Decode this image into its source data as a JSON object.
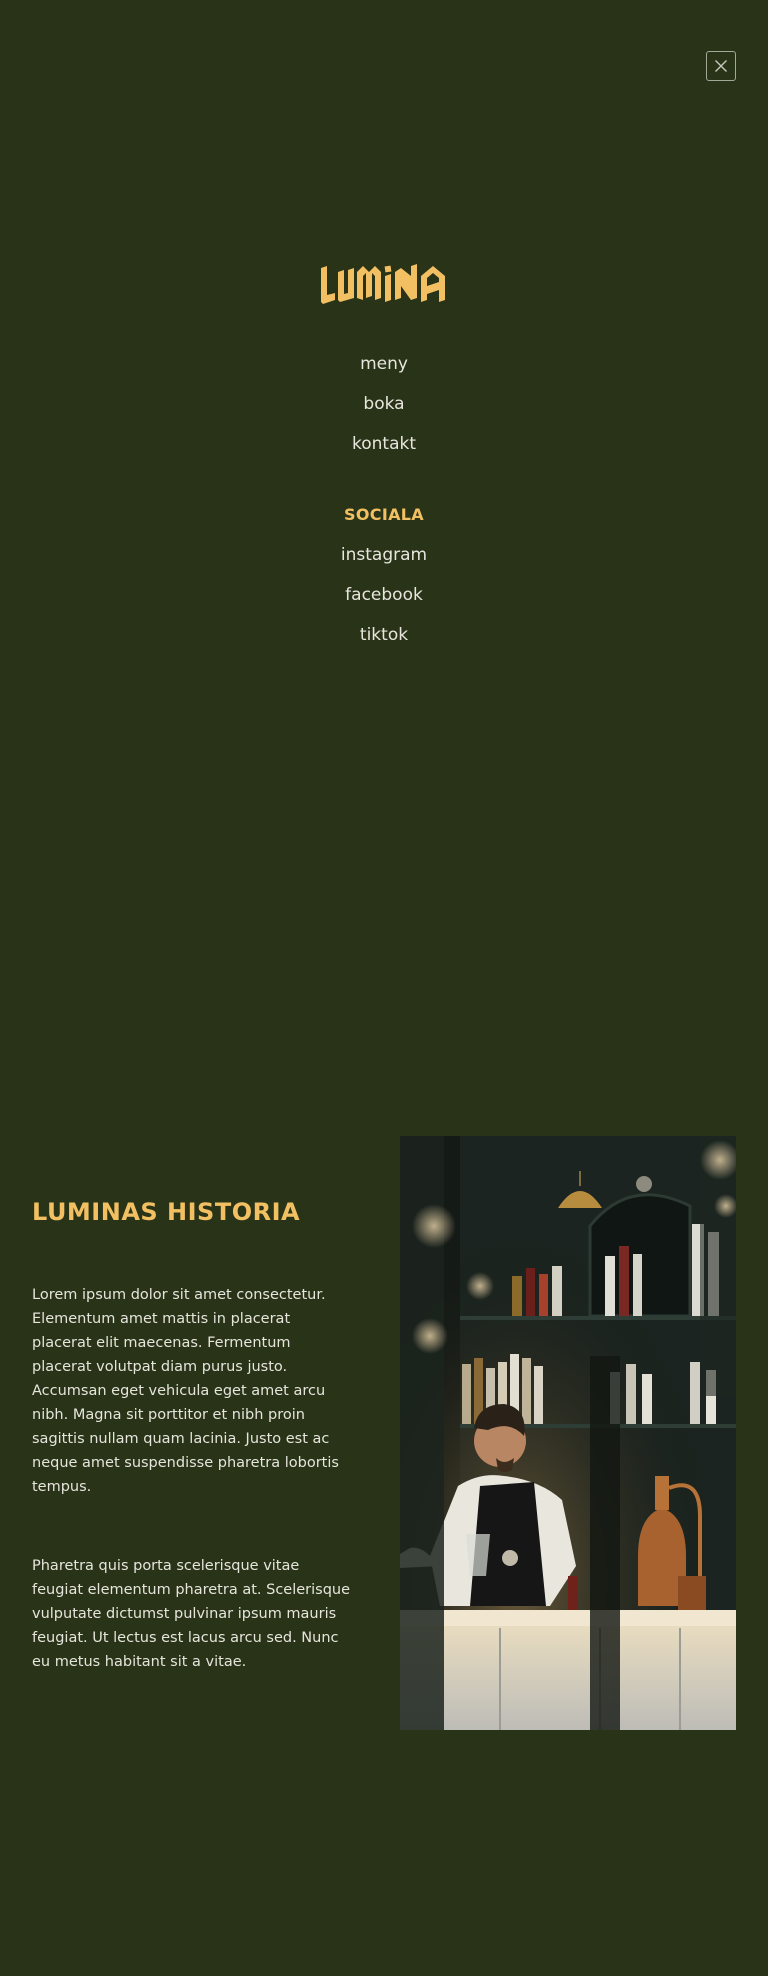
{
  "brand": {
    "logo_text": "LUMINA",
    "accent_color": "#f2c062",
    "background_color": "#283318"
  },
  "menu": {
    "close_icon": "close-icon",
    "nav_links": [
      "meny",
      "boka",
      "kontakt"
    ],
    "social_heading": "SOCIALA",
    "social_links": [
      "instagram",
      "facebook",
      "tiktok"
    ]
  },
  "story": {
    "title": "LUMINAS HISTORIA",
    "paragraphs": [
      "Lorem ipsum dolor sit amet consectetur. Elementum amet mattis in placerat placerat elit maecenas. Fermentum placerat volutpat diam purus justo. Accumsan eget vehicula eget amet arcu nibh. Magna sit porttitor et nibh proin sagittis nullam quam lacinia. Justo est ac neque amet suspendisse pharetra lobortis tempus.",
      "Pharetra quis porta scelerisque vitae feugiat elementum pharetra at. Scelerisque vulputate dictumst pulvinar ipsum mauris feugiat. Ut lectus est lacus arcu sed. Nunc eu metus habitant sit a vitae."
    ],
    "image_subject": "bartender-photo"
  }
}
